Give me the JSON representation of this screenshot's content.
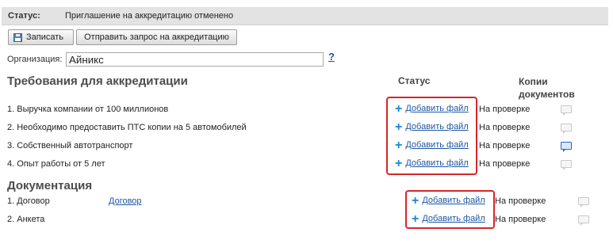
{
  "status_bar": {
    "label": "Статус:",
    "text": "Приглашение на аккредитацию отменено"
  },
  "toolbar": {
    "save_label": "Записать",
    "request_label": "Отправить запрос на аккредитацию"
  },
  "organization": {
    "label": "Организация:",
    "value": "Айникс",
    "help": "?"
  },
  "requirements": {
    "title": "Требования для аккредитации",
    "status_header": "Статус",
    "copies_header_line1": "Копии",
    "copies_header_line2": "документов",
    "rows": [
      {
        "label": "1. Выручка компании от 100 миллионов",
        "add": "Добавить файл",
        "status": "На проверке"
      },
      {
        "label": "2. Необходимо предоставить ПТС копии на 5 автомобилей",
        "add": "Добавить файл",
        "status": "На проверке"
      },
      {
        "label": "3. Собственный автотранспорт",
        "add": "Добавить файл",
        "status": "На проверке"
      },
      {
        "label": "4. Опыт работы от 5 лет",
        "add": "Добавить файл",
        "status": "На проверке"
      }
    ]
  },
  "documentation": {
    "title": "Документация",
    "rows": [
      {
        "label": "1. Договор",
        "link": "Договор",
        "add": "Добавить файл",
        "status": "На проверке"
      },
      {
        "label": "2. Анкета",
        "add": "Добавить файл",
        "status": "На проверке"
      }
    ]
  },
  "colors": {
    "link": "#1f56a3",
    "plus": "#1c86d0",
    "highlight": "#d6262b",
    "header_bg": "#e3e3e3"
  },
  "icons": {
    "add": "plus-icon",
    "comment": "comment-icon",
    "save": "floppy-disk-icon"
  }
}
